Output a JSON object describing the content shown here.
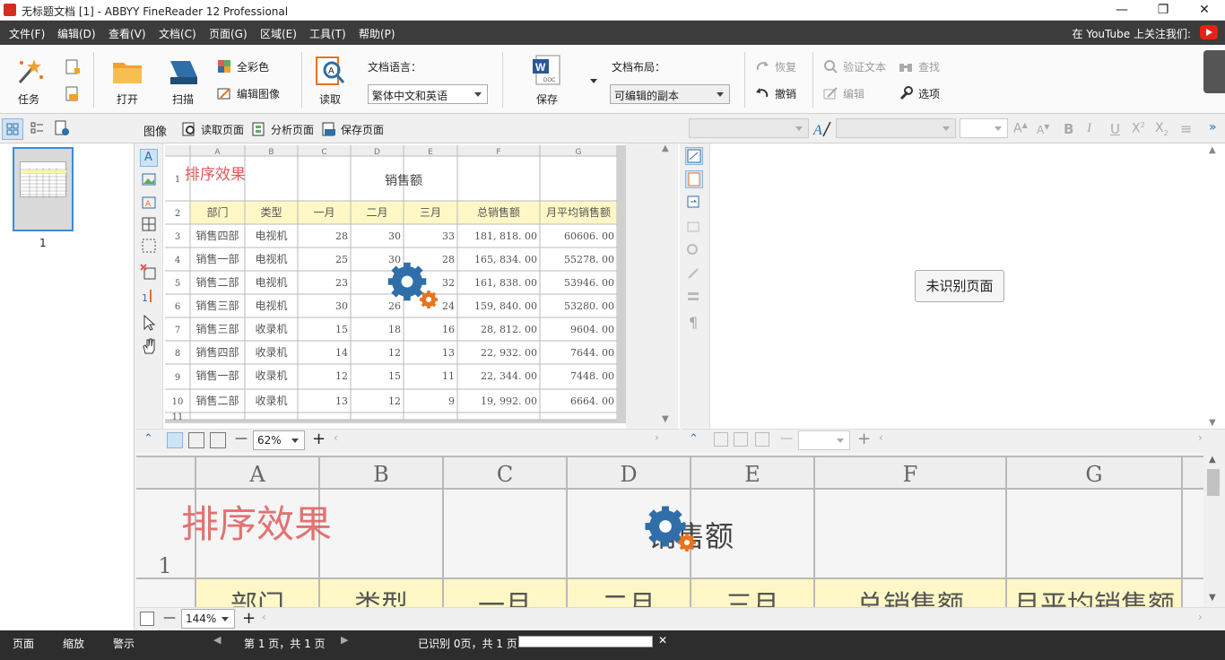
{
  "window": {
    "title": "无标题文档 [1] - ABBYY FineReader 12 Professional",
    "minimize": "—",
    "restore": "❐",
    "close": "✕"
  },
  "menu": {
    "items": [
      "文件(F)",
      "编辑(D)",
      "查看(V)",
      "文档(C)",
      "页面(G)",
      "区域(E)",
      "工具(T)",
      "帮助(P)"
    ],
    "youtube_text": "在 YouTube 上关注我们:"
  },
  "ribbon": {
    "task_label": "任务",
    "open_label": "打开",
    "scan_label": "扫描",
    "fullcolor_label": "全彩色",
    "edit_image_label": "编辑图像",
    "read_label": "读取",
    "doc_language_label": "文档语言：",
    "doc_language_value": "繁体中文和英语",
    "save_label": "保存",
    "doc_layout_label": "文档布局：",
    "doc_layout_value": "可编辑的副本",
    "redo_label": "恢复",
    "undo_label": "撤销",
    "verify_text_label": "验证文本",
    "edit_label": "编辑",
    "find_label": "查找",
    "options_label": "选项",
    "word_doc_caption": "DOC"
  },
  "image_toolbar": {
    "image_label": "图像",
    "read_page_label": "读取页面",
    "analyze_page_label": "分析页面",
    "save_page_label": "保存页面"
  },
  "thumbnails": {
    "pages": [
      {
        "number": "1"
      }
    ]
  },
  "image_pane": {
    "zoom_value": "62%",
    "zoom_minus": "—",
    "zoom_plus": "+"
  },
  "text_pane": {
    "unrecognized_label": "未识别页面",
    "zoom_minus": "—",
    "zoom_plus": "+"
  },
  "zoom_pane": {
    "zoom_value": "144%",
    "zoom_minus": "—",
    "zoom_plus": "+"
  },
  "sheet": {
    "col_letters": [
      "A",
      "B",
      "C",
      "D",
      "E",
      "F",
      "G"
    ],
    "row_numbers": [
      "1",
      "2",
      "3",
      "4",
      "5",
      "6",
      "7",
      "8",
      "9",
      "10",
      "11"
    ],
    "overlay_title": "排序效果",
    "title": "销售额",
    "headers": [
      "部门",
      "类型",
      "一月",
      "二月",
      "三月",
      "总销售额",
      "月平均销售额"
    ],
    "rows": [
      [
        "销售四部",
        "电视机",
        "28",
        "30",
        "33",
        "181, 818. 00",
        "60606. 00"
      ],
      [
        "销售一部",
        "电视机",
        "25",
        "30",
        "28",
        "165, 834. 00",
        "55278. 00"
      ],
      [
        "销售二部",
        "电视机",
        "23",
        "",
        "32",
        "161, 838. 00",
        "53946. 00"
      ],
      [
        "销售三部",
        "电视机",
        "30",
        "26",
        "24",
        "159, 840. 00",
        "53280. 00"
      ],
      [
        "销售三部",
        "收录机",
        "15",
        "18",
        "16",
        "28, 812. 00",
        "9604. 00"
      ],
      [
        "销售四部",
        "收录机",
        "14",
        "12",
        "13",
        "22, 932. 00",
        "7644. 00"
      ],
      [
        "销售一部",
        "收录机",
        "12",
        "15",
        "11",
        "22, 344. 00",
        "7448. 00"
      ],
      [
        "销售二部",
        "收录机",
        "13",
        "12",
        "9",
        "19, 992. 00",
        "6664. 00"
      ]
    ],
    "zoom_partial_headers": [
      "部门",
      "类型",
      "一月",
      "二月",
      "三月",
      "总销售额",
      "月平均销售额"
    ]
  },
  "statusbar": {
    "tab_pages": "页面",
    "tab_zoom": "缩放",
    "tab_warnings": "警示",
    "page_info": "第 1 页，共 1 页",
    "recognized_info": "已识别 0页，共 1 页",
    "cancel": "✕"
  },
  "colors": {
    "accent_blue": "#2f6ea8",
    "gear_orange": "#e8731f",
    "red_overlay": "#e05a5a",
    "header_fill": "#fff8c6"
  }
}
